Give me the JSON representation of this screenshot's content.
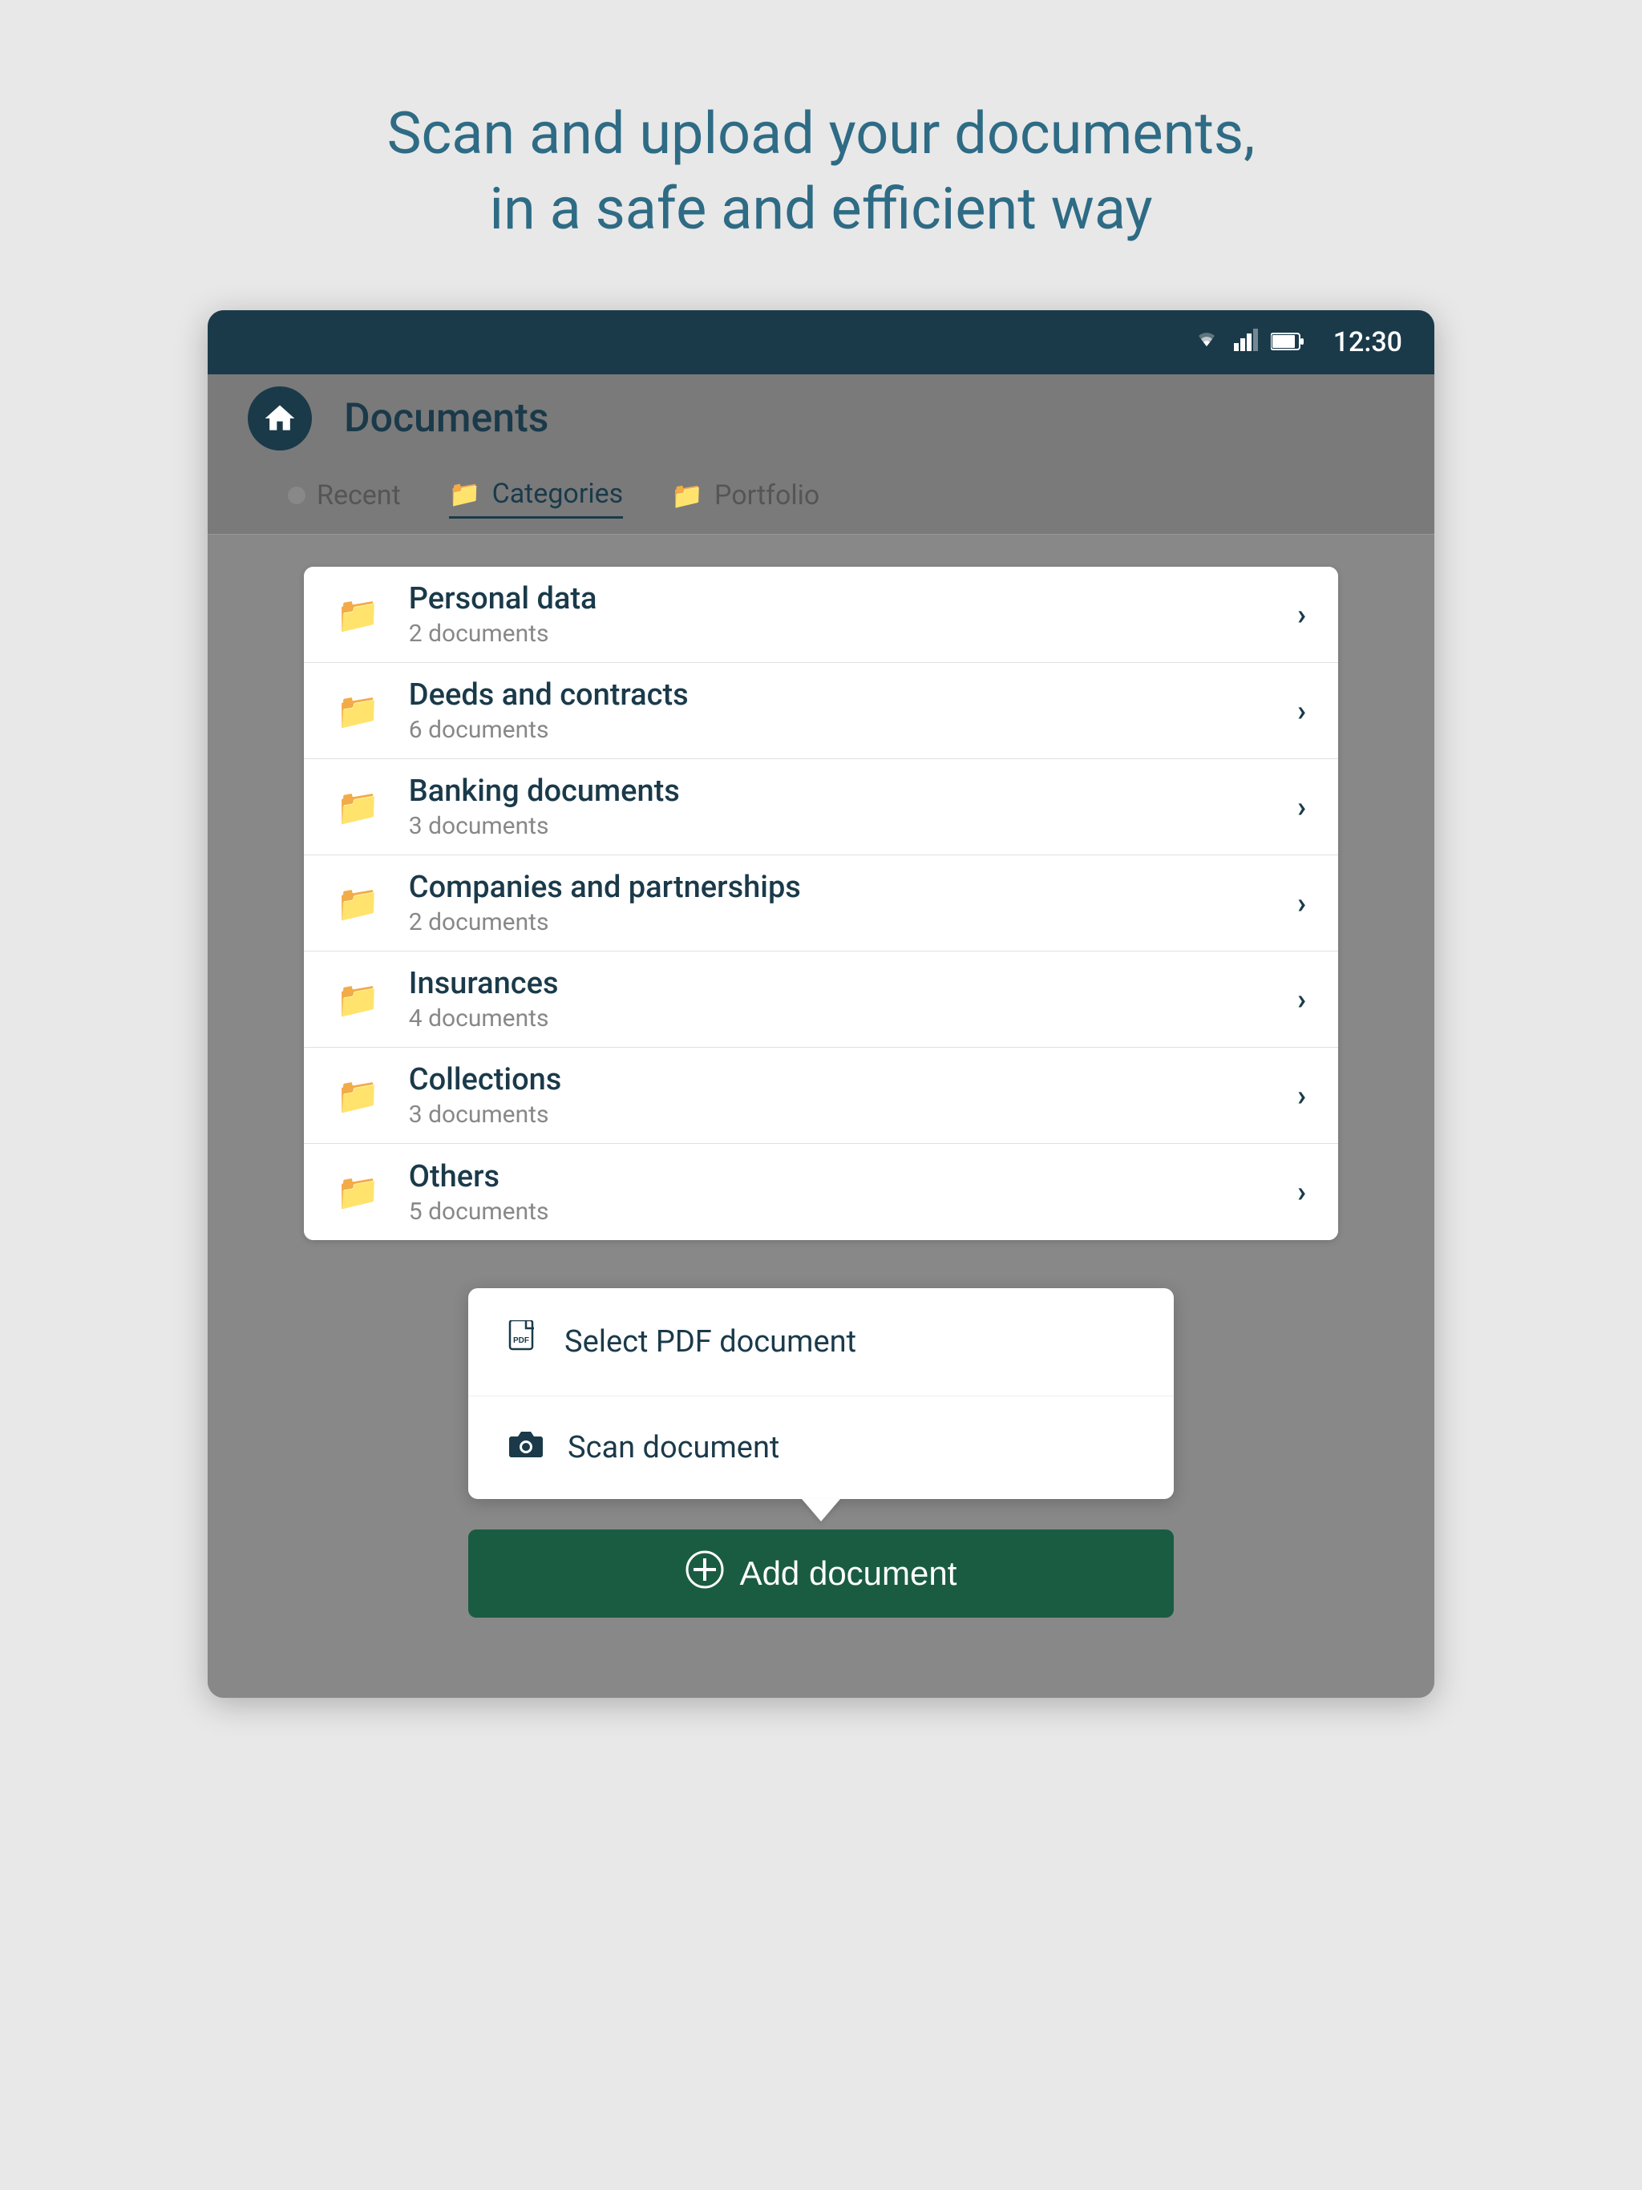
{
  "hero": {
    "line1": "Scan and upload your documents,",
    "line2": "in a safe and efficient way"
  },
  "statusBar": {
    "time": "12:30"
  },
  "header": {
    "title": "Documents"
  },
  "tabs": [
    {
      "id": "recent",
      "label": "Recent",
      "active": false,
      "icon": "dot"
    },
    {
      "id": "categories",
      "label": "Categories",
      "active": true,
      "icon": "folder"
    },
    {
      "id": "portfolio",
      "label": "Portfolio",
      "active": false,
      "icon": "folder"
    }
  ],
  "categories": [
    {
      "id": "personal-data",
      "name": "Personal data",
      "count": "2 documents"
    },
    {
      "id": "deeds-contracts",
      "name": "Deeds and contracts",
      "count": "6 documents"
    },
    {
      "id": "banking",
      "name": "Banking documents",
      "count": "3 documents"
    },
    {
      "id": "companies",
      "name": "Companies and partnerships",
      "count": "2 documents"
    },
    {
      "id": "insurances",
      "name": "Insurances",
      "count": "4 documents"
    },
    {
      "id": "collections",
      "name": "Collections",
      "count": "3 documents"
    },
    {
      "id": "others",
      "name": "Others",
      "count": "5 documents"
    }
  ],
  "popup": {
    "items": [
      {
        "id": "select-pdf",
        "label": "Select PDF document",
        "icon": "pdf"
      },
      {
        "id": "scan-doc",
        "label": "Scan document",
        "icon": "camera"
      }
    ]
  },
  "addButton": {
    "label": "Add document"
  }
}
